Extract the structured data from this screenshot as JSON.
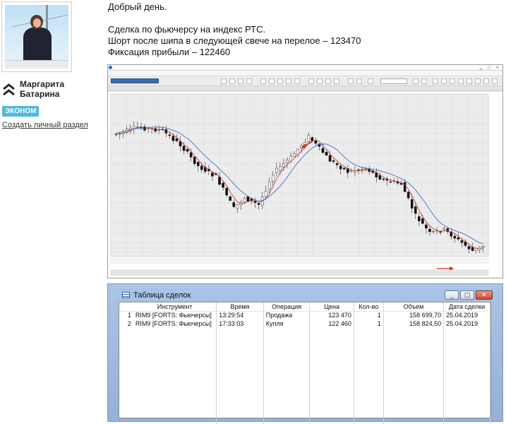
{
  "author": {
    "name_line1": "Маргарита",
    "name_line2": "Батарина",
    "badge": "ЭКОНОМ",
    "create_section_link": "Создать личный раздел"
  },
  "post": {
    "greeting": "Добрый день.",
    "line1": "Сделка по фьючерсу на индекс РТС.",
    "line2": "Шорт после шипа в следующей свече на перелое – 123470",
    "line3": "Фиксация прибыли – 122460"
  },
  "colors": {
    "badge": "#4fb8e0",
    "bull_candle": "#ffffff",
    "bear_candle": "#111111",
    "ma_fast": "#c0392b",
    "ma_slow": "#2f5fc4",
    "entry_arrow": "#e02020",
    "exit_arrow": "#e02020"
  },
  "trades_window": {
    "title": "Таблица сделок",
    "buttons": [
      "minimize",
      "maximize",
      "close"
    ],
    "columns": [
      "Инструмент",
      "Время",
      "Операция",
      "Цена",
      "Кол-во",
      "Объем",
      "Дата сделки"
    ],
    "rows": [
      {
        "num": "1",
        "instrument": "RIM9 [FORTS: Фьючерсы]",
        "time": "13:29:54",
        "operation": "Продажа",
        "price": "123 470",
        "qty": "1",
        "volume": "158 699,70",
        "date": "25.04.2019"
      },
      {
        "num": "2",
        "instrument": "RIM9 [FORTS: Фьючерсы]",
        "time": "17:33:03",
        "operation": "Купля",
        "price": "122 460",
        "qty": "1",
        "volume": "158 824,50",
        "date": "25.04.2019"
      }
    ]
  }
}
